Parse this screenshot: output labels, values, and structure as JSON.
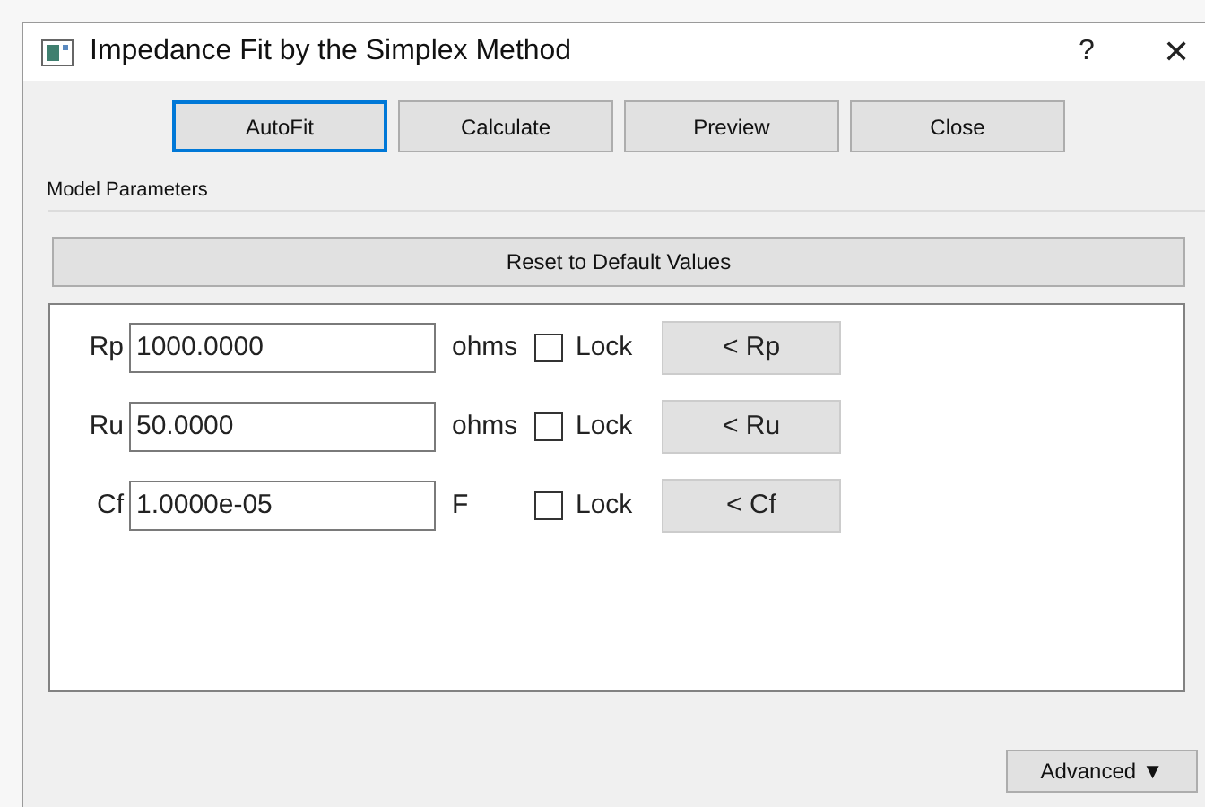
{
  "window": {
    "title": "Impedance Fit by the Simplex Method",
    "help": "?",
    "close": "✕"
  },
  "buttons": [
    {
      "label": "AutoFit",
      "selected": true
    },
    {
      "label": "Calculate",
      "selected": false
    },
    {
      "label": "Preview",
      "selected": false
    },
    {
      "label": "Close",
      "selected": false
    }
  ],
  "group": {
    "title": "Model Parameters",
    "reset": "Reset to Default Values"
  },
  "params": [
    {
      "name": "Rp",
      "value": "1000.0000",
      "unit": "ohms",
      "lock": "Lock",
      "checked": false,
      "action": "< Rp"
    },
    {
      "name": "Ru",
      "value": "50.0000",
      "unit": "ohms",
      "lock": "Lock",
      "checked": false,
      "action": "< Ru"
    },
    {
      "name": "Cf",
      "value": "1.0000e-05",
      "unit": "F",
      "lock": "Lock",
      "checked": false,
      "action": "< Cf"
    }
  ],
  "advanced": "Advanced ▼"
}
